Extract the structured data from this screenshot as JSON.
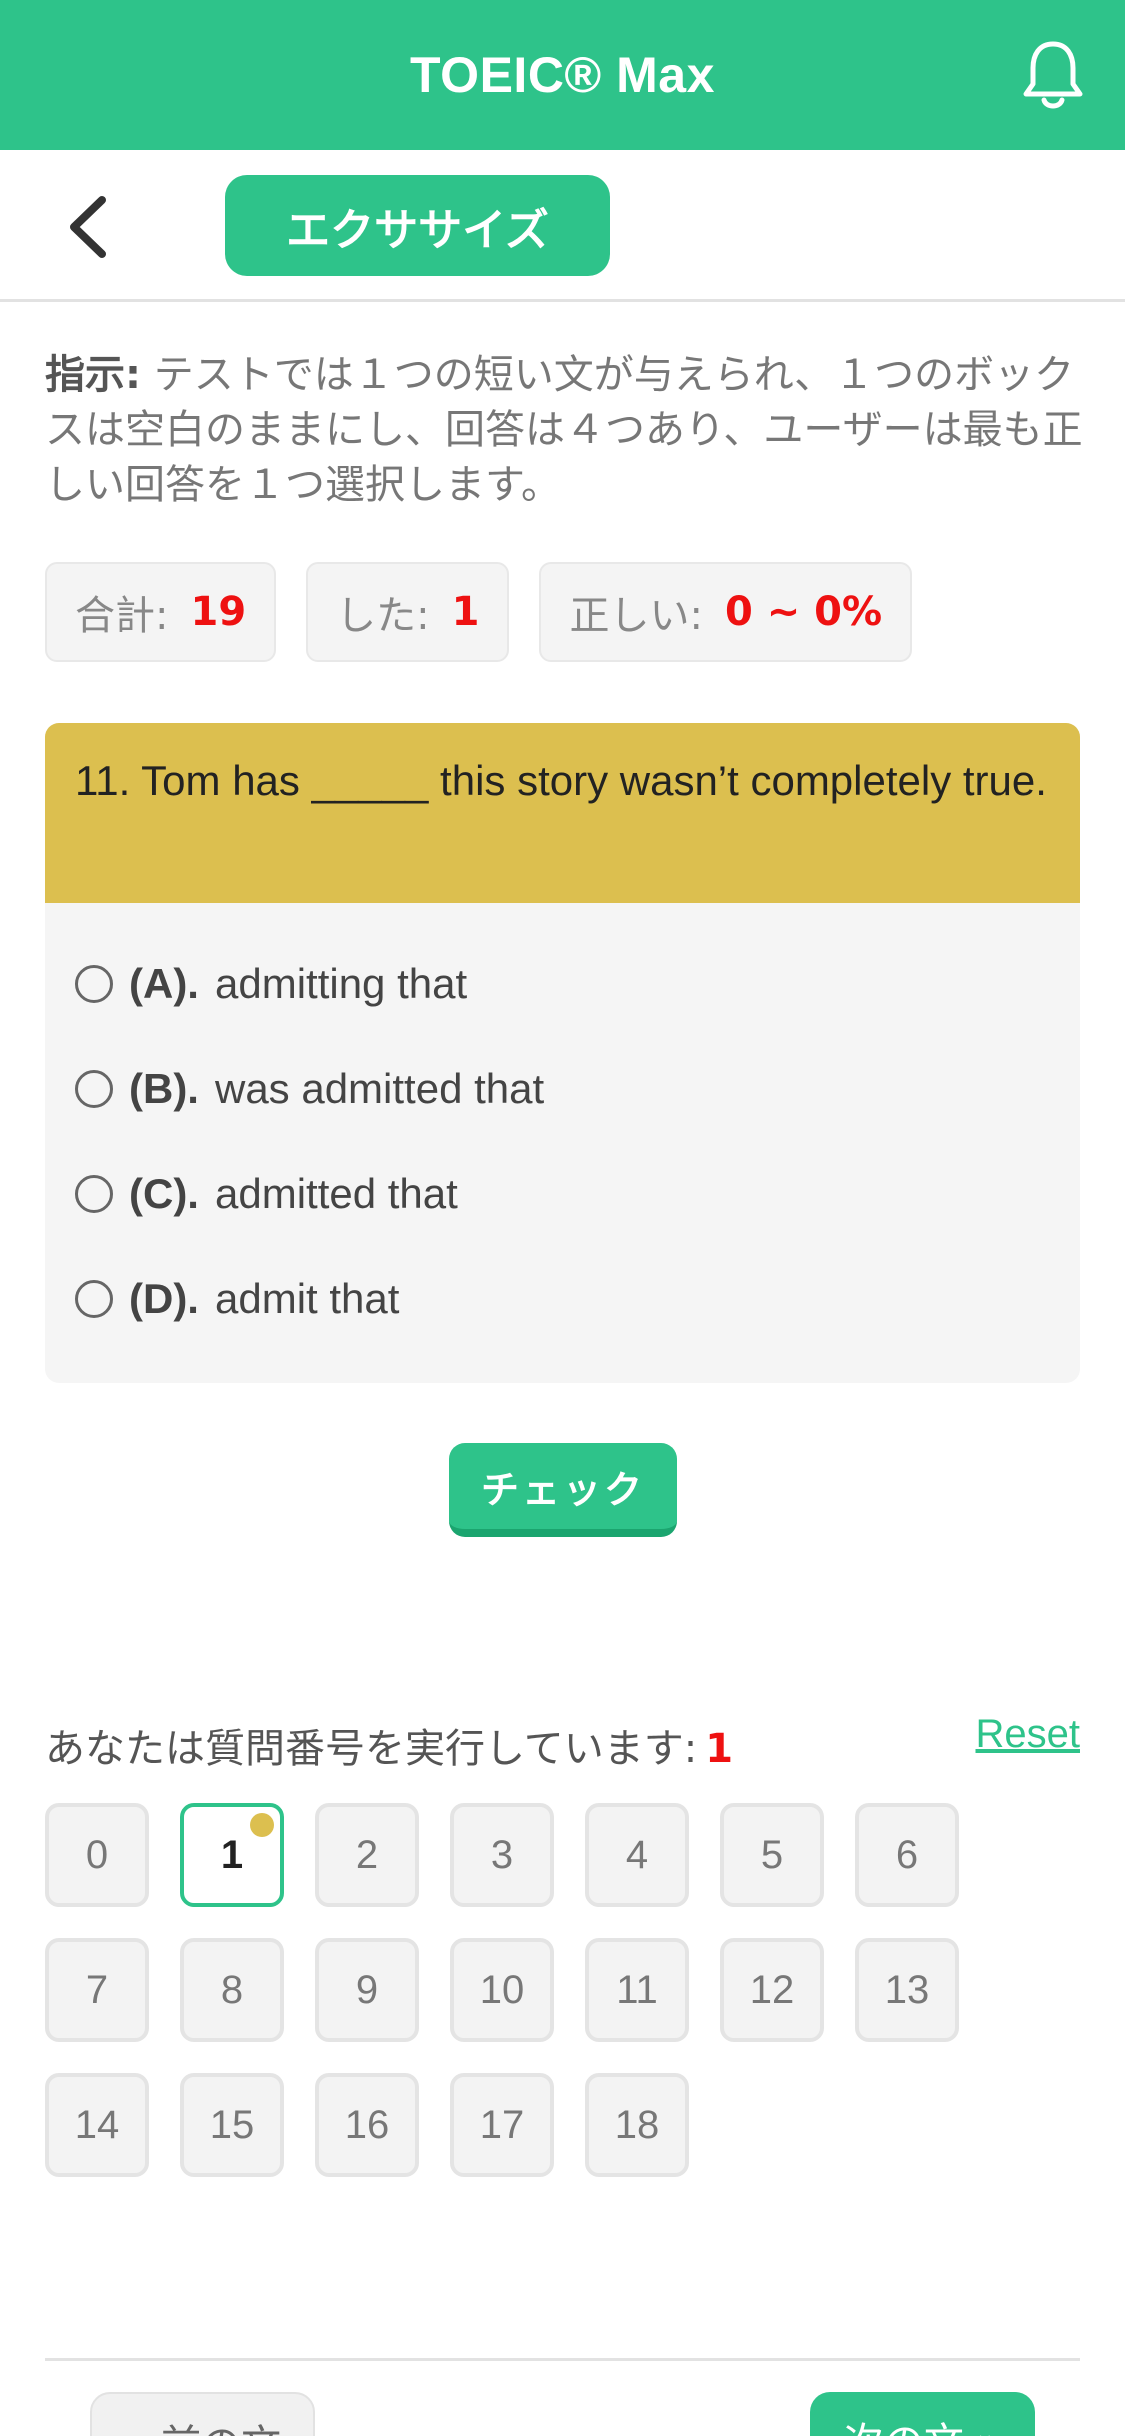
{
  "header": {
    "title": "TOEIC® Max",
    "notification_icon": "bell-icon"
  },
  "subnav": {
    "back_icon": "chevron-left-icon",
    "tab_label": "エクササイズ"
  },
  "instructions": {
    "label": "指示:",
    "text": " テストでは１つの短い文が与えられ、１つのボックスは空白のままにし、回答は４つあり、ユーザーは最も正しい回答を１つ選択します。"
  },
  "stats": {
    "total_label": "合計:",
    "total_value": "19",
    "done_label": "した:",
    "done_value": "1",
    "correct_label": "正しい:",
    "correct_value": "0 ~ 0%"
  },
  "question": {
    "text": "11. Tom has _____ this story wasn’t completely true.",
    "options": [
      {
        "letter": "(A).",
        "text": "admitting that"
      },
      {
        "letter": "(B).",
        "text": "was admitted that"
      },
      {
        "letter": "(C).",
        "text": "admitted that"
      },
      {
        "letter": "(D).",
        "text": "admit that"
      }
    ]
  },
  "check_label": "チェック",
  "progress": {
    "running_label": "あなたは質問番号を実行しています:",
    "current": "1",
    "reset_label": "Reset",
    "numbers": [
      "0",
      "1",
      "2",
      "3",
      "4",
      "5",
      "6",
      "7",
      "8",
      "9",
      "10",
      "11",
      "12",
      "13",
      "14",
      "15",
      "16",
      "17",
      "18"
    ],
    "active_index": 1
  },
  "footer": {
    "prev_label": "« 前の文",
    "next_label": "次の文 »"
  },
  "colors": {
    "primary": "#2ec38a",
    "question_bg": "#dcbf4f",
    "accent_red": "#e11111"
  }
}
